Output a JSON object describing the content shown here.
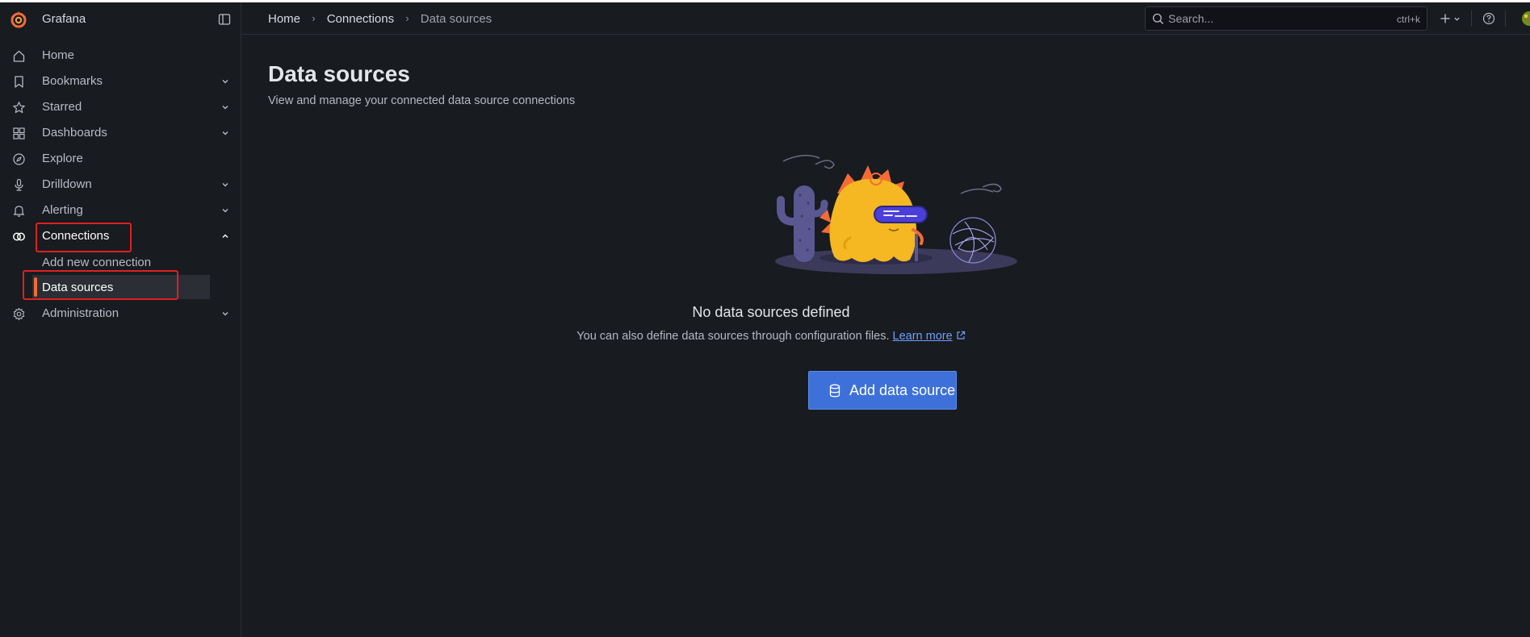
{
  "app": {
    "title": "Grafana"
  },
  "sidebar": {
    "items": [
      {
        "label": "Home",
        "icon": "home-icon",
        "expandable": false
      },
      {
        "label": "Bookmarks",
        "icon": "bookmark-icon",
        "expandable": true
      },
      {
        "label": "Starred",
        "icon": "star-icon",
        "expandable": true
      },
      {
        "label": "Dashboards",
        "icon": "apps-icon",
        "expandable": true
      },
      {
        "label": "Explore",
        "icon": "compass-icon",
        "expandable": false
      },
      {
        "label": "Drilldown",
        "icon": "drilldown-icon",
        "expandable": true
      },
      {
        "label": "Alerting",
        "icon": "bell-icon",
        "expandable": true
      },
      {
        "label": "Connections",
        "icon": "link-icon",
        "expandable": true,
        "expanded": true
      },
      {
        "label": "Administration",
        "icon": "gear-icon",
        "expandable": true
      }
    ],
    "connections_children": [
      {
        "label": "Add new connection"
      },
      {
        "label": "Data sources",
        "selected": true
      }
    ]
  },
  "breadcrumb": {
    "items": [
      "Home",
      "Connections",
      "Data sources"
    ]
  },
  "search": {
    "placeholder": "Search...",
    "shortcut": "ctrl+k"
  },
  "page": {
    "title": "Data sources",
    "subtitle": "View and manage your connected data source connections"
  },
  "empty_state": {
    "title": "No data sources defined",
    "text": "You can also define data sources through configuration files.",
    "link_text": "Learn more",
    "button_label": "Add data source"
  },
  "colors": {
    "accent_orange": "#f46b36",
    "primary_button": "#3d71d9",
    "link": "#6e9fff",
    "highlight_box": "#e02020"
  }
}
